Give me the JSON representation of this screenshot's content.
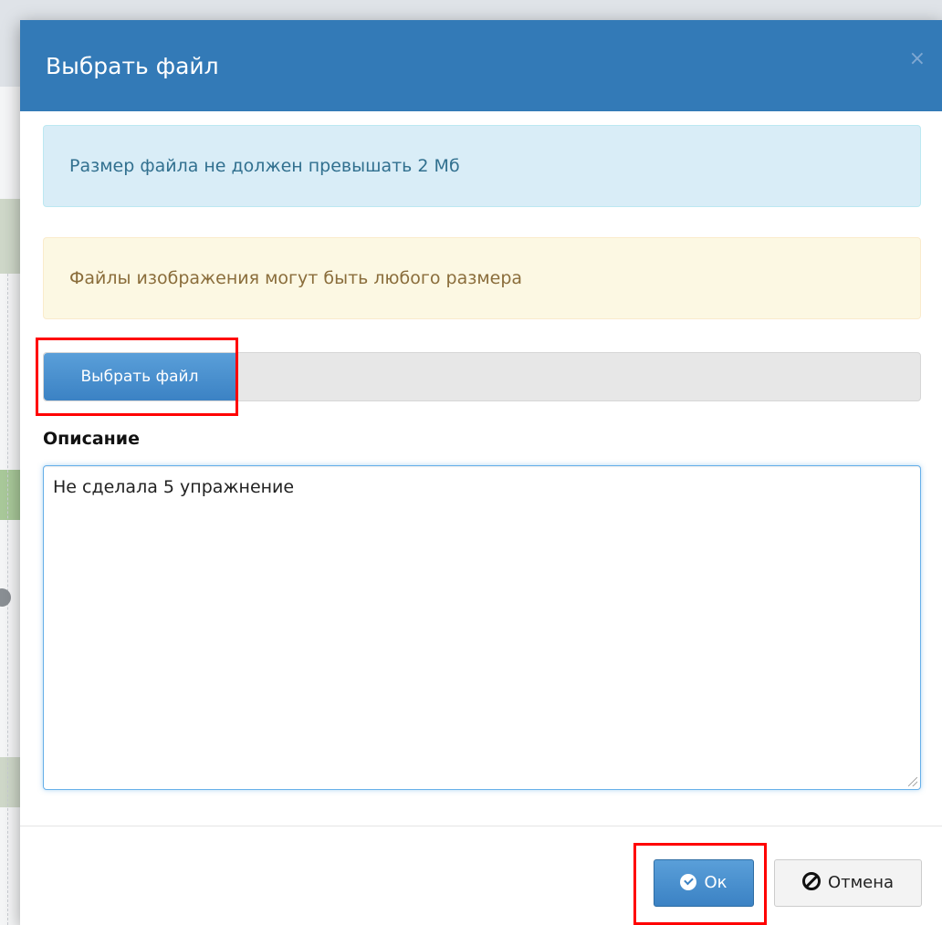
{
  "dialog": {
    "title": "Выбрать файл",
    "close_label": "×"
  },
  "alerts": {
    "info": "Размер файла не должен превышать 2 Мб",
    "warning": "Файлы изображения могут быть любого размера"
  },
  "file_input": {
    "button_label": "Выбрать файл"
  },
  "description": {
    "label": "Описание",
    "value": "Не сделала 5 упражнение"
  },
  "footer": {
    "ok_label": "Ок",
    "cancel_label": "Отмена"
  },
  "colors": {
    "header": "#337ab7",
    "highlight": "#ff0000",
    "info_bg": "#d9edf7",
    "warning_bg": "#fcf8e3"
  },
  "icons": {
    "ok": "check-circle-icon",
    "cancel": "ban-icon"
  }
}
